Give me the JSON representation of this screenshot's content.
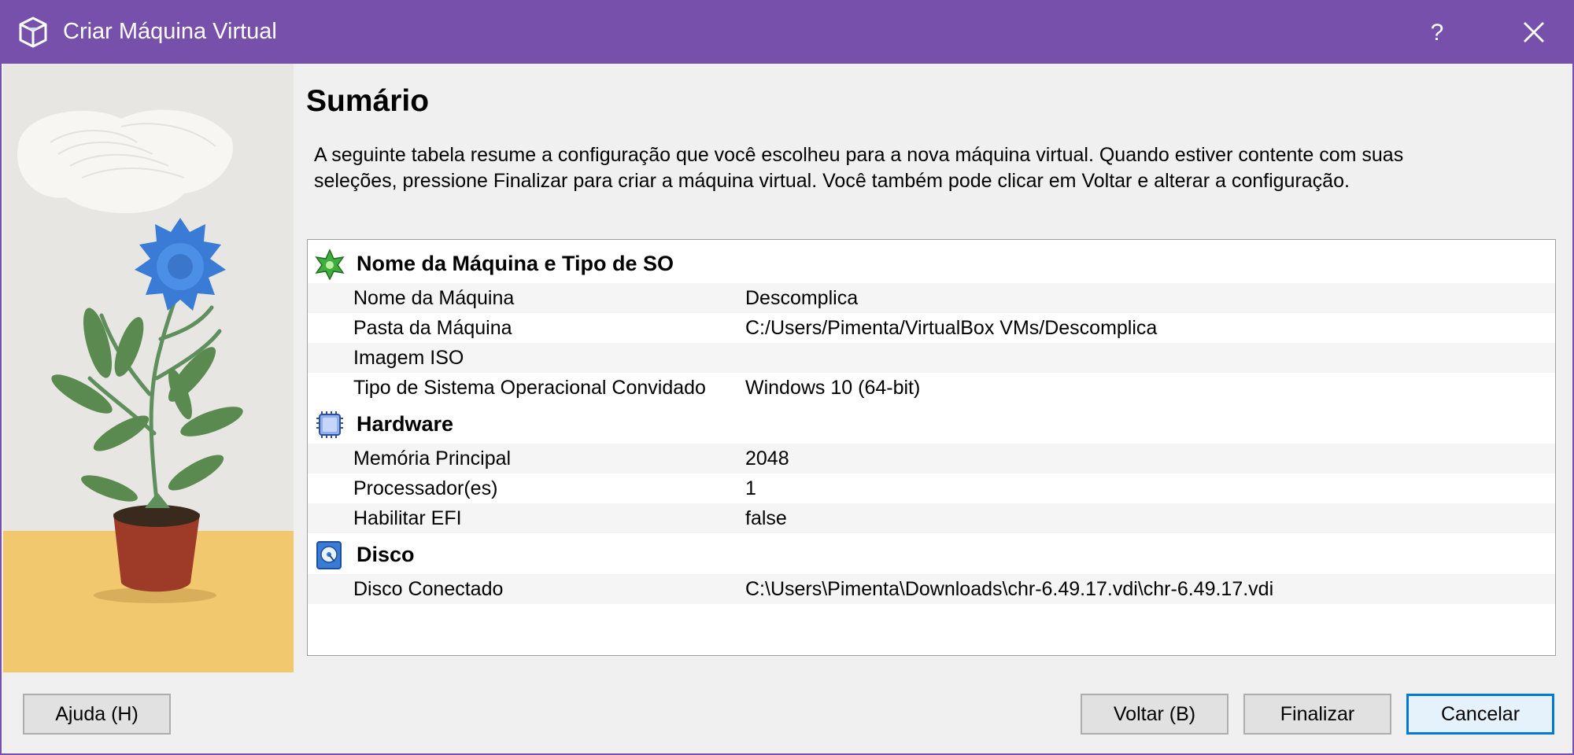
{
  "window": {
    "title": "Criar Máquina Virtual",
    "help_label": "?"
  },
  "page": {
    "heading": "Sumário",
    "description": "A seguinte tabela resume a configuração que você escolheu para a nova máquina virtual. Quando estiver contente com suas seleções, pressione Finalizar para criar a máquina virtual. Você também pode clicar em Voltar e alterar a configuração."
  },
  "summary": {
    "name_section": {
      "title": "Nome da Máquina e Tipo de SO",
      "rows": [
        {
          "label": "Nome da Máquina",
          "value": "Descomplica"
        },
        {
          "label": "Pasta da Máquina",
          "value": "C:/Users/Pimenta/VirtualBox VMs/Descomplica"
        },
        {
          "label": "Imagem ISO",
          "value": ""
        },
        {
          "label": "Tipo de Sistema Operacional Convidado",
          "value": "Windows 10 (64-bit)"
        }
      ]
    },
    "hardware_section": {
      "title": "Hardware",
      "rows": [
        {
          "label": "Memória Principal",
          "value": "2048"
        },
        {
          "label": "Processador(es)",
          "value": "1"
        },
        {
          "label": "Habilitar EFI",
          "value": "false"
        }
      ]
    },
    "disk_section": {
      "title": "Disco",
      "rows": [
        {
          "label": "Disco Conectado",
          "value": "C:\\Users\\Pimenta\\Downloads\\chr-6.49.17.vdi\\chr-6.49.17.vdi"
        }
      ]
    }
  },
  "buttons": {
    "help": "Ajuda (H)",
    "back": "Voltar (B)",
    "finish": "Finalizar",
    "cancel": "Cancelar"
  },
  "colors": {
    "titlebar": "#7650ab",
    "dialog_bg": "#f0f0f0",
    "default_button_border": "#0078d7"
  },
  "icons": {
    "app": "virtualbox-cube-icon",
    "name_section": "green-star-icon",
    "hardware_section": "chip-icon",
    "disk_section": "hard-disk-icon"
  }
}
